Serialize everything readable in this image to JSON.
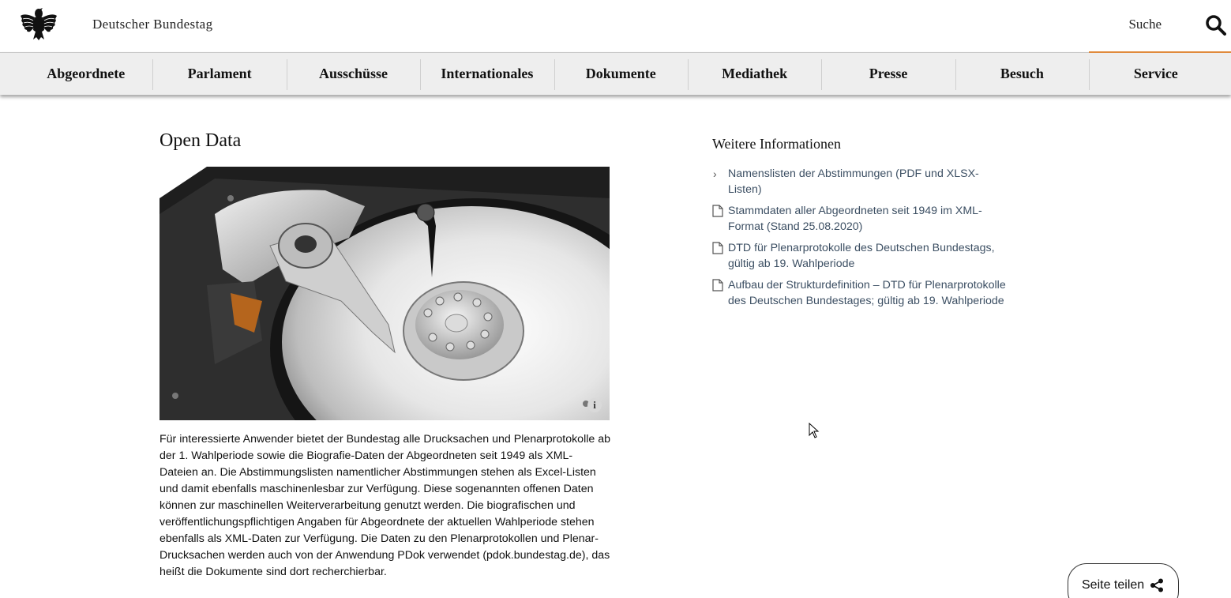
{
  "header": {
    "site_title": "Deutscher Bundestag",
    "search_label": "Suche"
  },
  "nav": {
    "items": [
      "Abgeordnete",
      "Parlament",
      "Ausschüsse",
      "Internationales",
      "Dokumente",
      "Mediathek",
      "Presse",
      "Besuch",
      "Service"
    ],
    "active": "Service"
  },
  "main": {
    "title": "Open Data",
    "image_info_label": "i",
    "intro": "Für interessierte Anwender bietet der Bundestag alle Drucksachen und Plenarprotokolle ab der 1. Wahlperiode sowie die Biografie-Daten der Abgeordneten seit 1949 als XML-Dateien an. Die Abstimmungslisten namentlicher Abstimmungen stehen als Excel-Listen und damit ebenfalls maschinenlesbar zur Verfügung. Diese sogenannten offenen Daten können zur maschinellen Weiterverarbeitung genutzt werden. Die biografischen und veröffentlichungspflichtigen Angaben für Abgeordnete der aktuellen Wahlperiode stehen ebenfalls als XML-Daten zur Verfügung. Die Daten zu den Plenarprotokollen und Plenar-Drucksachen werden auch von der Anwendung PDok verwendet (pdok.bundestag.de), das heißt die Dokumente sind dort recherchierbar."
  },
  "sidebar": {
    "heading": "Weitere Informationen",
    "links": [
      {
        "label": "Namenslisten der Abstimmungen (PDF und XLSX-Listen)",
        "icon": "chevron-right-icon"
      },
      {
        "label": "Stammdaten aller Abgeordneten seit 1949 im XML-Format (Stand 25.08.2020)",
        "icon": "document-icon"
      },
      {
        "label": "DTD für Plenarprotokolle des Deutschen Bundestags, gültig ab 19. Wahlperiode",
        "icon": "document-icon"
      },
      {
        "label": "Aufbau der Strukturdefinition – DTD für Plenarprotokolle des Deutschen Bundestages; gültig ab 19. Wahlperiode",
        "icon": "document-icon"
      }
    ]
  },
  "share": {
    "label": "Seite teilen",
    "icon": "share-icon"
  },
  "colors": {
    "nav_background": "#eeeeee",
    "active_accent": "#e08a3c",
    "link_color": "#3c4f63"
  }
}
